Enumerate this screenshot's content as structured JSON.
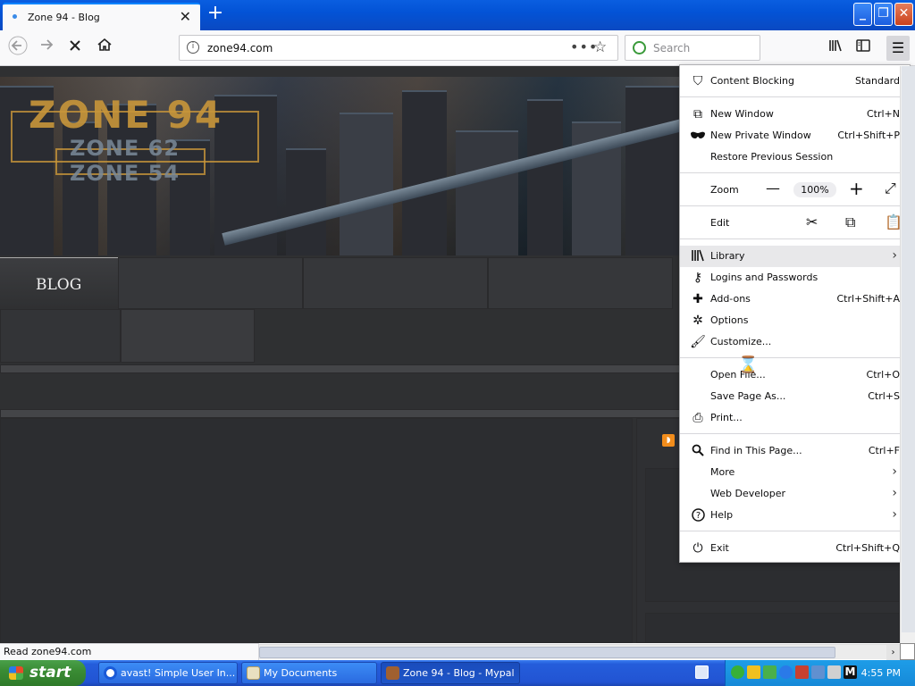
{
  "browser": {
    "tab_title": "Zone 94 - Blog",
    "new_tab_symbol": "+",
    "url": "zone94.com",
    "page_actions": "•••",
    "search_placeholder": "Search"
  },
  "page": {
    "logo_main": "ZONE 94",
    "logo_line2": "ZONE 62",
    "logo_line3": "ZONE 54",
    "nav_blog": "BLOG"
  },
  "menu": {
    "content_blocking": {
      "label": "Content Blocking",
      "value": "Standard"
    },
    "new_window": {
      "label": "New Window",
      "shortcut": "Ctrl+N"
    },
    "new_private_window": {
      "label": "New Private Window",
      "shortcut": "Ctrl+Shift+P"
    },
    "restore_session": {
      "label": "Restore Previous Session"
    },
    "zoom": {
      "label": "Zoom",
      "value": "100%"
    },
    "edit": {
      "label": "Edit"
    },
    "library": {
      "label": "Library"
    },
    "logins": {
      "label": "Logins and Passwords"
    },
    "addons": {
      "label": "Add-ons",
      "shortcut": "Ctrl+Shift+A"
    },
    "options": {
      "label": "Options"
    },
    "customize": {
      "label": "Customize..."
    },
    "open_file": {
      "label": "Open File...",
      "shortcut": "Ctrl+O"
    },
    "save_page": {
      "label": "Save Page As...",
      "shortcut": "Ctrl+S"
    },
    "print": {
      "label": "Print..."
    },
    "find": {
      "label": "Find in This Page...",
      "shortcut": "Ctrl+F"
    },
    "more": {
      "label": "More"
    },
    "web_developer": {
      "label": "Web Developer"
    },
    "help": {
      "label": "Help"
    },
    "exit": {
      "label": "Exit",
      "shortcut": "Ctrl+Shift+Q"
    }
  },
  "status_text": "Read zone94.com",
  "taskbar": {
    "start_label": "start",
    "tasks": [
      {
        "label": "avast! Simple User In..."
      },
      {
        "label": "My Documents"
      },
      {
        "label": "Zone 94 - Blog - Mypal"
      }
    ],
    "clock": "4:55 PM"
  },
  "icons": {
    "tab_close": "close-icon",
    "back": "back-arrow-icon",
    "forward": "forward-arrow-icon",
    "stop": "stop-icon",
    "home": "home-icon",
    "hamburger": "menu-icon"
  },
  "colors": {
    "titlebar": "#0353d6",
    "taskbar": "#2254d3",
    "start_button": "#3a8c34",
    "page_bg": "#2f3032",
    "logo_gold": "#c8963a"
  }
}
